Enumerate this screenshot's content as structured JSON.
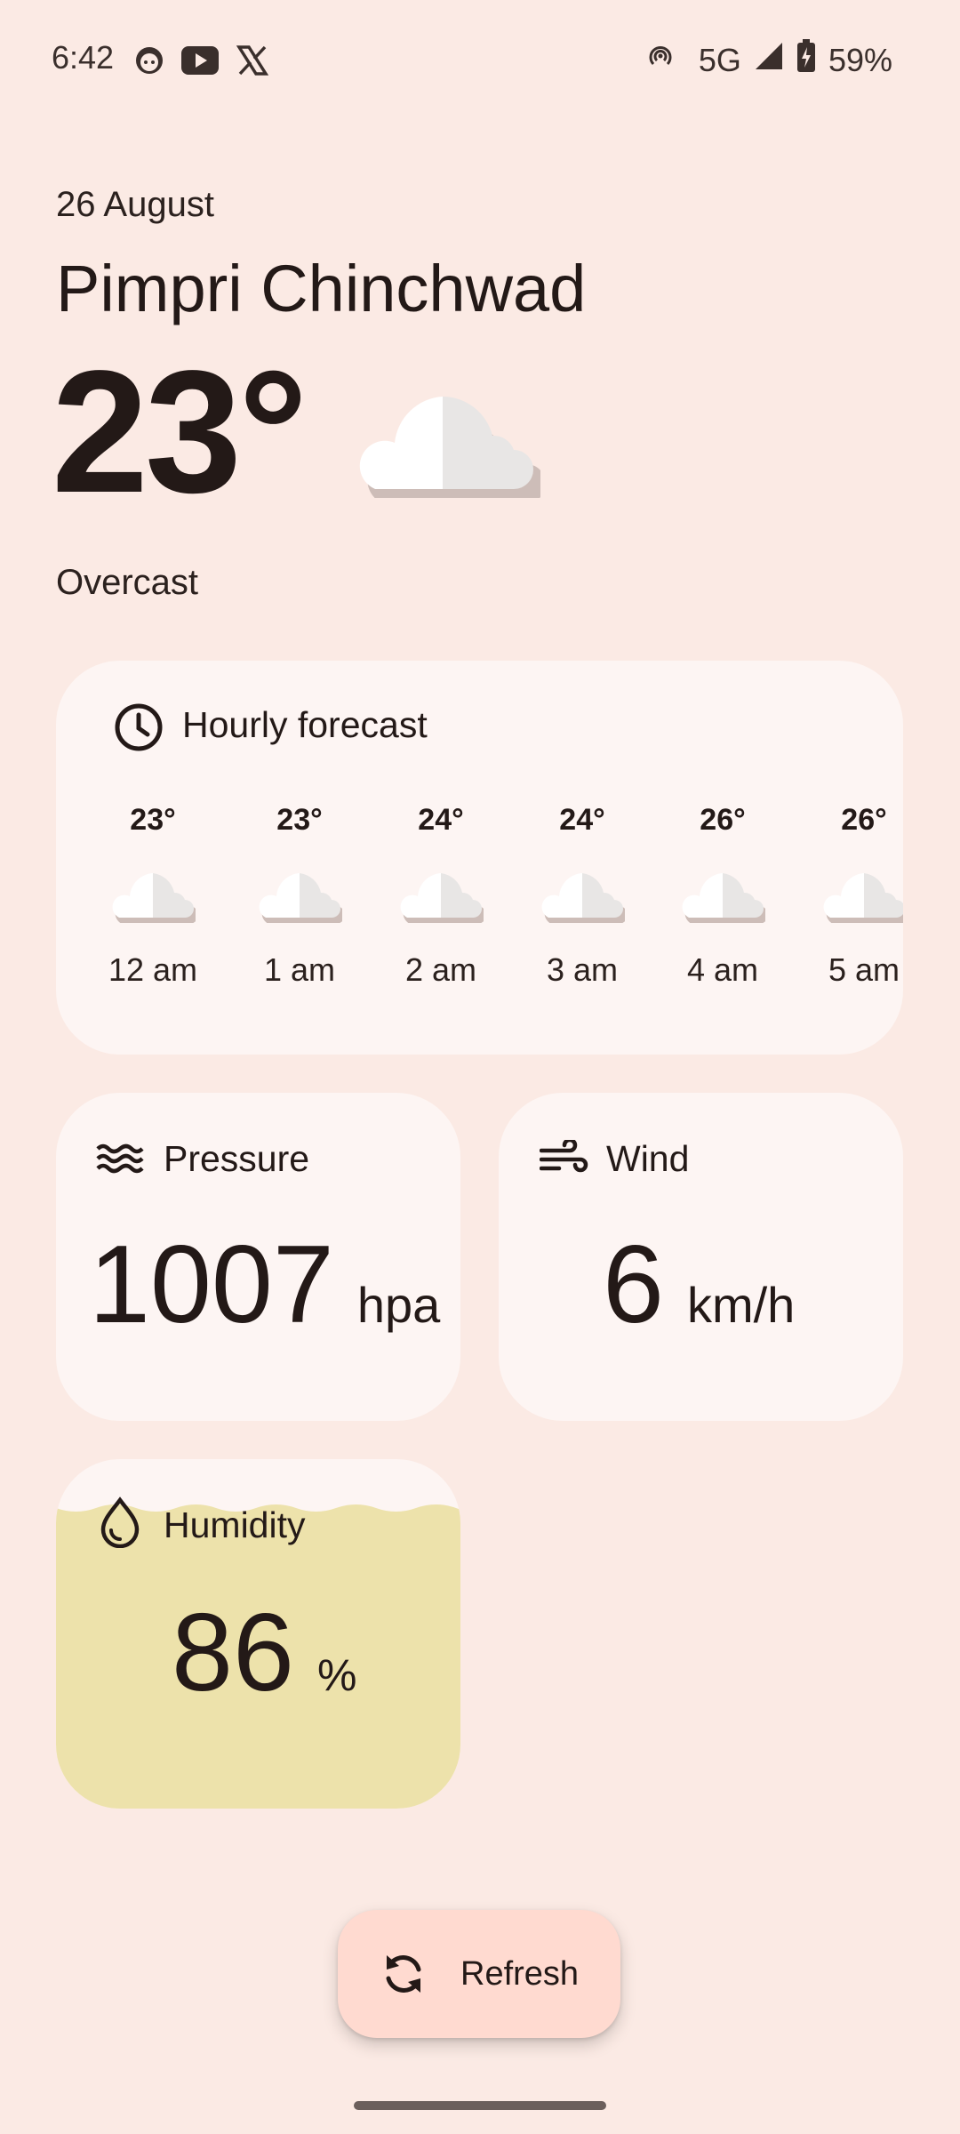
{
  "status_bar": {
    "time": "6:42",
    "network": "5G",
    "battery": "59%",
    "left_icons": [
      "face-icon",
      "youtube-icon",
      "x-icon"
    ],
    "right_icons": [
      "hotspot-icon",
      "signal-icon",
      "battery-charging-icon"
    ]
  },
  "header": {
    "date": "26 August",
    "city": "Pimpri Chinchwad",
    "temperature": "23°",
    "condition": "Overcast",
    "condition_icon": "cloud-icon"
  },
  "hourly": {
    "title": "Hourly forecast",
    "icon": "clock-icon",
    "items": [
      {
        "temp": "23°",
        "time": "12 am"
      },
      {
        "temp": "23°",
        "time": "1 am"
      },
      {
        "temp": "24°",
        "time": "2 am"
      },
      {
        "temp": "24°",
        "time": "3 am"
      },
      {
        "temp": "26°",
        "time": "4 am"
      },
      {
        "temp": "26°",
        "time": "5 am"
      }
    ]
  },
  "pressure": {
    "title": "Pressure",
    "value": "1007",
    "unit": "hpa",
    "icon": "waves-icon"
  },
  "wind": {
    "title": "Wind",
    "value": "6",
    "unit": "km/h",
    "icon": "wind-icon"
  },
  "humidity": {
    "title": "Humidity",
    "value": "86",
    "unit": "%",
    "icon": "water-drop-icon",
    "level_percent": 86,
    "fill_color": "#ede2ab"
  },
  "refresh": {
    "label": "Refresh",
    "icon": "refresh-icon"
  },
  "colors": {
    "background": "#fbeae4",
    "card": "#fdf5f3",
    "fab": "#ffdad0",
    "text": "#231917"
  }
}
